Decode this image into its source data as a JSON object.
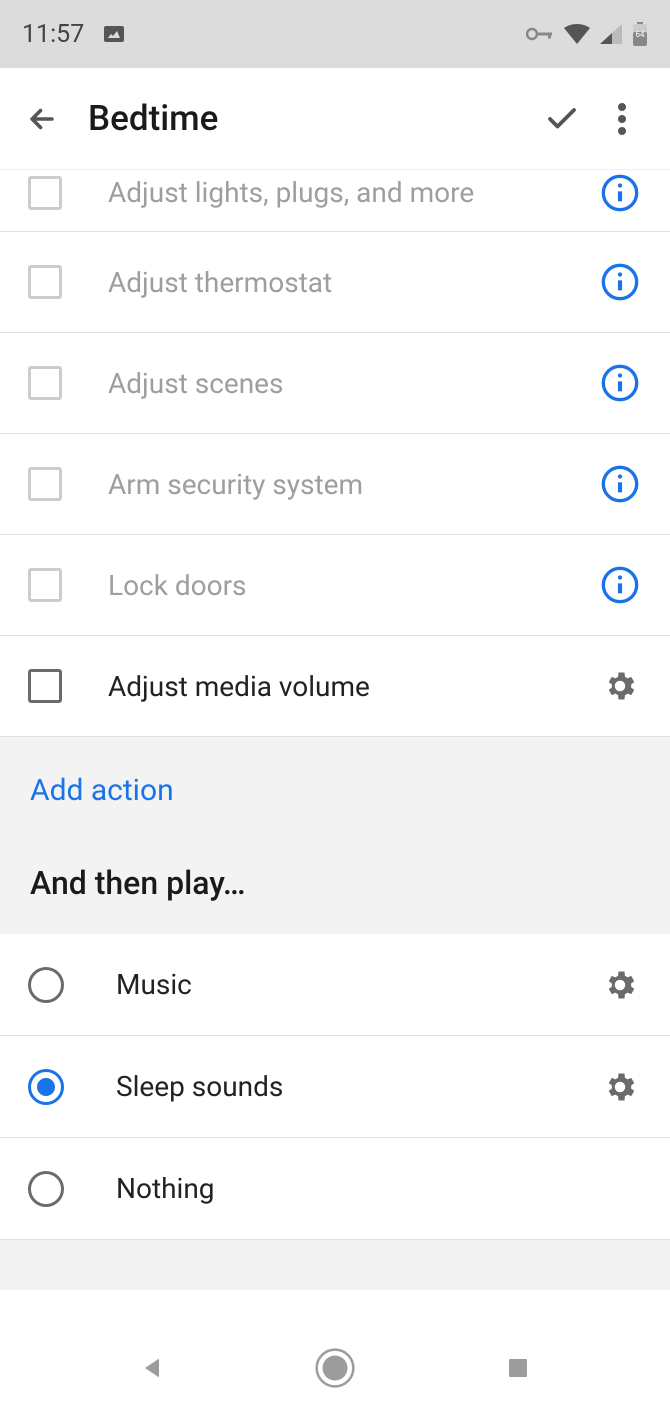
{
  "status": {
    "time": "11:57",
    "battery": "64"
  },
  "header": {
    "title": "Bedtime"
  },
  "actions": [
    {
      "label": "Adjust lights, plugs, and more",
      "checked": false,
      "enabled": false,
      "icon": "info"
    },
    {
      "label": "Adjust thermostat",
      "checked": false,
      "enabled": false,
      "icon": "info"
    },
    {
      "label": "Adjust scenes",
      "checked": false,
      "enabled": false,
      "icon": "info"
    },
    {
      "label": "Arm security system",
      "checked": false,
      "enabled": false,
      "icon": "info"
    },
    {
      "label": "Lock doors",
      "checked": false,
      "enabled": false,
      "icon": "info"
    },
    {
      "label": "Adjust media volume",
      "checked": false,
      "enabled": true,
      "icon": "gear"
    }
  ],
  "add_action_label": "Add action",
  "play_header": "And then play…",
  "play_options": [
    {
      "label": "Music",
      "selected": false,
      "gear": true
    },
    {
      "label": "Sleep sounds",
      "selected": true,
      "gear": true
    },
    {
      "label": "Nothing",
      "selected": false,
      "gear": false
    }
  ]
}
